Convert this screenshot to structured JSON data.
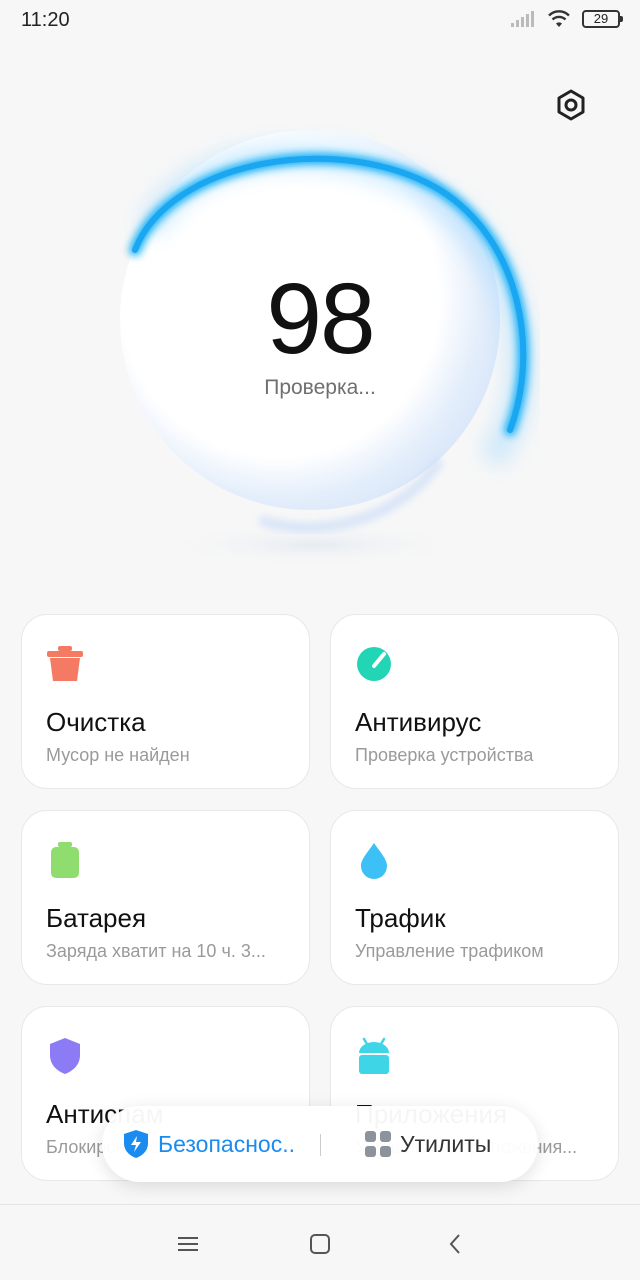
{
  "status_bar": {
    "time": "11:20",
    "battery": "29"
  },
  "score": {
    "value": "98",
    "status": "Проверка..."
  },
  "cards": [
    {
      "title": "Очистка",
      "subtitle": "Мусор не найден",
      "icon": "trash-icon",
      "color": "#f47a63"
    },
    {
      "title": "Антивирус",
      "subtitle": "Проверка устройства",
      "icon": "antivirus-gauge-icon",
      "color": "#22d6b5"
    },
    {
      "title": "Батарея",
      "subtitle": "Заряда хватит на 10 ч. 3...",
      "icon": "battery-icon",
      "color": "#8fdc6f"
    },
    {
      "title": "Трафик",
      "subtitle": "Управление трафиком",
      "icon": "water-drop-icon",
      "color": "#3cc0f5"
    },
    {
      "title": "Антиспам",
      "subtitle": "Блокировка спама",
      "icon": "shield-icon",
      "color": "#8b7cf6"
    },
    {
      "title": "Приложения",
      "subtitle": "Управление приложения...",
      "icon": "android-icon",
      "color": "#3ed6e6"
    }
  ],
  "tabs": {
    "security": {
      "label": "Безопаснос..",
      "icon": "shield-bolt-icon"
    },
    "utilities": {
      "label": "Утилиты",
      "icon": "grid-icon"
    }
  },
  "colors": {
    "accent": "#1a8cf0",
    "sphere_ring": "#1ab2f5"
  }
}
